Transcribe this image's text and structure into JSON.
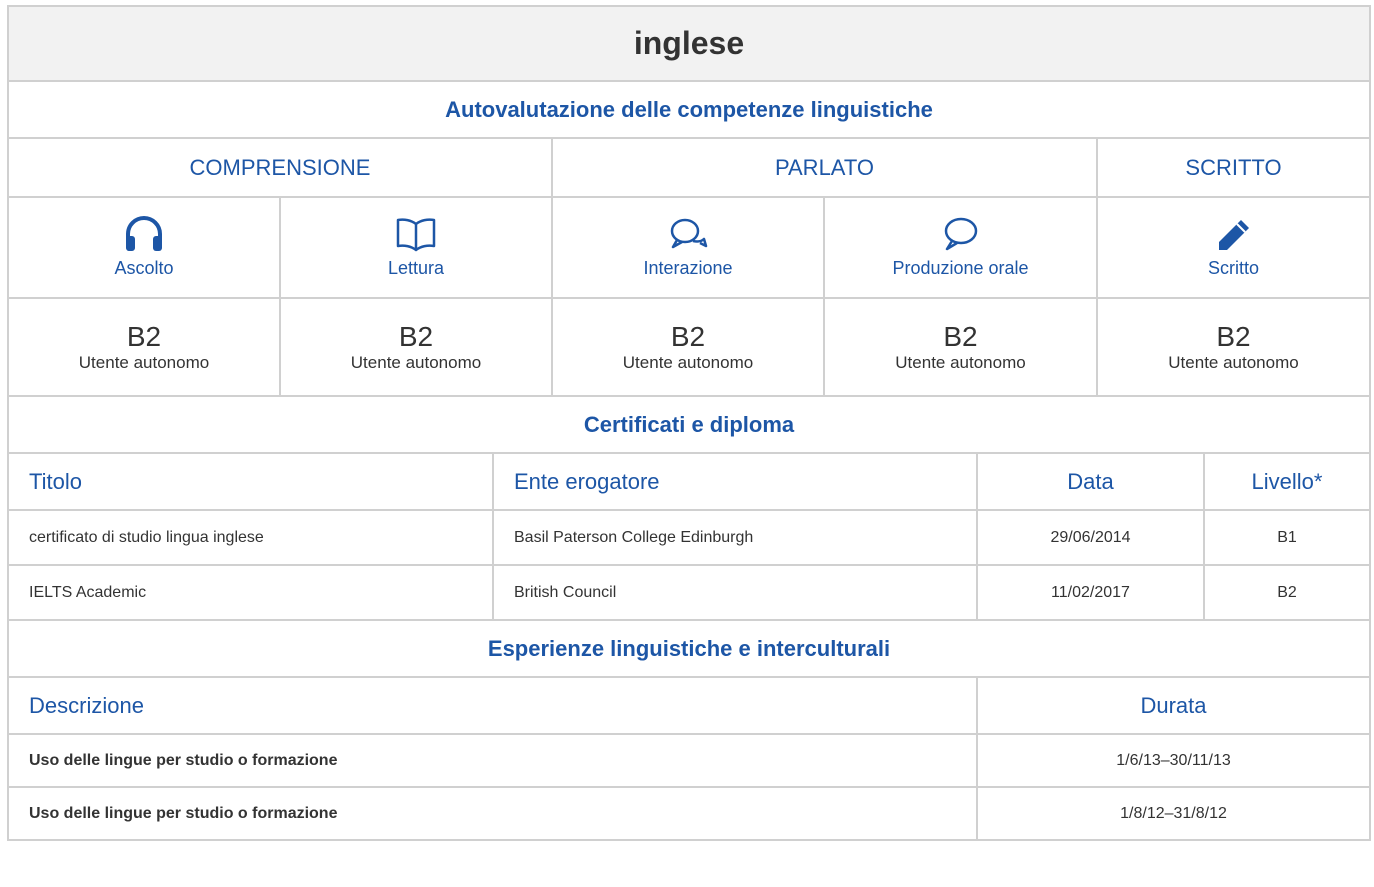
{
  "language": "inglese",
  "self_assessment": {
    "heading": "Autovalutazione delle competenze linguistiche",
    "groups": [
      "COMPRENSIONE",
      "PARLATO",
      "SCRITTO"
    ],
    "skills": [
      {
        "label": "Ascolto",
        "icon": "headphones-icon",
        "level": "B2",
        "level_desc": "Utente autonomo"
      },
      {
        "label": "Lettura",
        "icon": "book-icon",
        "level": "B2",
        "level_desc": "Utente autonomo"
      },
      {
        "label": "Interazione",
        "icon": "conversation-icon",
        "level": "B2",
        "level_desc": "Utente autonomo"
      },
      {
        "label": "Produzione orale",
        "icon": "speech-bubble-icon",
        "level": "B2",
        "level_desc": "Utente autonomo"
      },
      {
        "label": "Scritto",
        "icon": "pencil-icon",
        "level": "B2",
        "level_desc": "Utente autonomo"
      }
    ]
  },
  "certificates": {
    "heading": "Certificati e diploma",
    "columns": [
      "Titolo",
      "Ente erogatore",
      "Data",
      "Livello*"
    ],
    "rows": [
      [
        "certificato di studio lingua inglese",
        "Basil Paterson College Edinburgh",
        "29/06/2014",
        "B1"
      ],
      [
        "IELTS Academic",
        "British Council",
        "11/02/2017",
        "B2"
      ]
    ]
  },
  "experiences": {
    "heading": "Esperienze linguistiche e interculturali",
    "columns": [
      "Descrizione",
      "Durata"
    ],
    "rows": [
      [
        "Uso delle lingue per studio o formazione",
        "1/6/13–30/11/13"
      ],
      [
        "Uso delle lingue per studio o formazione",
        "1/8/12–31/8/12"
      ]
    ]
  },
  "colors": {
    "accent": "#1d56a6",
    "border": "#d0d0d0",
    "title_bg": "#f2f2f2",
    "text": "#333333"
  }
}
